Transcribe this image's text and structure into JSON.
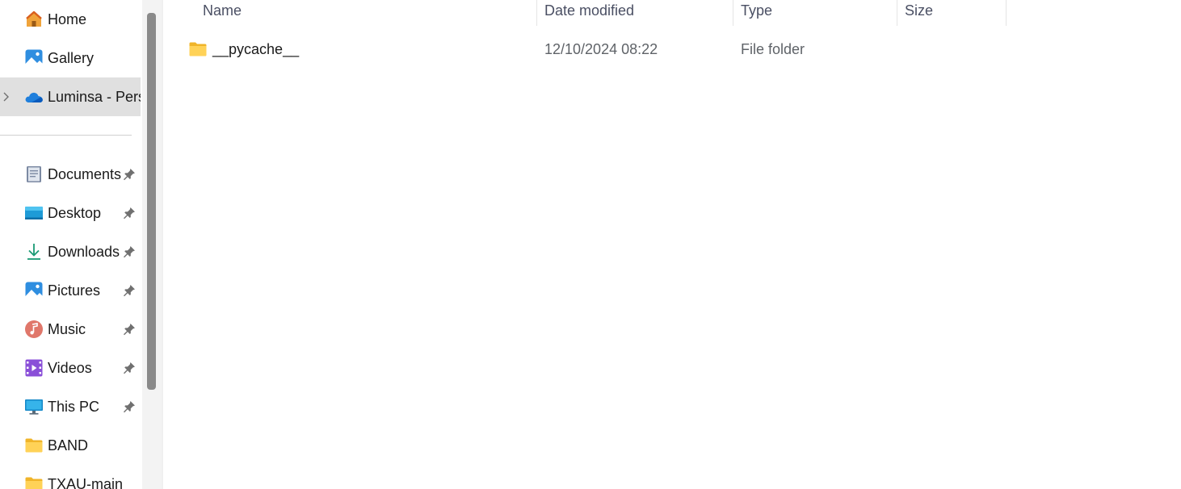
{
  "navigation": {
    "items": [
      {
        "label": "Home",
        "icon": "home-icon"
      },
      {
        "label": "Gallery",
        "icon": "gallery-icon"
      },
      {
        "label": "Luminsa - Pers",
        "icon": "onedrive-cloud-icon",
        "selected": true,
        "expandable": true
      },
      {
        "label": "Documents",
        "icon": "documents-icon",
        "pinned": true
      },
      {
        "label": "Desktop",
        "icon": "desktop-icon",
        "pinned": true
      },
      {
        "label": "Downloads",
        "icon": "downloads-icon",
        "pinned": true
      },
      {
        "label": "Pictures",
        "icon": "pictures-icon",
        "pinned": true
      },
      {
        "label": "Music",
        "icon": "music-icon",
        "pinned": true
      },
      {
        "label": "Videos",
        "icon": "videos-icon",
        "pinned": true
      },
      {
        "label": "This PC",
        "icon": "this-pc-icon",
        "pinned": true
      },
      {
        "label": "BAND",
        "icon": "folder-icon"
      },
      {
        "label": "TXAU-main",
        "icon": "folder-icon"
      }
    ]
  },
  "file_list": {
    "columns": [
      "Name",
      "Date modified",
      "Type",
      "Size"
    ],
    "rows": [
      {
        "name": "__pycache__",
        "date_modified": "12/10/2024 08:22",
        "type": "File folder",
        "size": "",
        "icon": "folder-icon"
      }
    ]
  },
  "colors": {
    "selected_bg": "#e0e0e0",
    "folder_yellow": "#f8c94b",
    "header_text": "#4a4f63",
    "muted_text": "#5f6368"
  }
}
